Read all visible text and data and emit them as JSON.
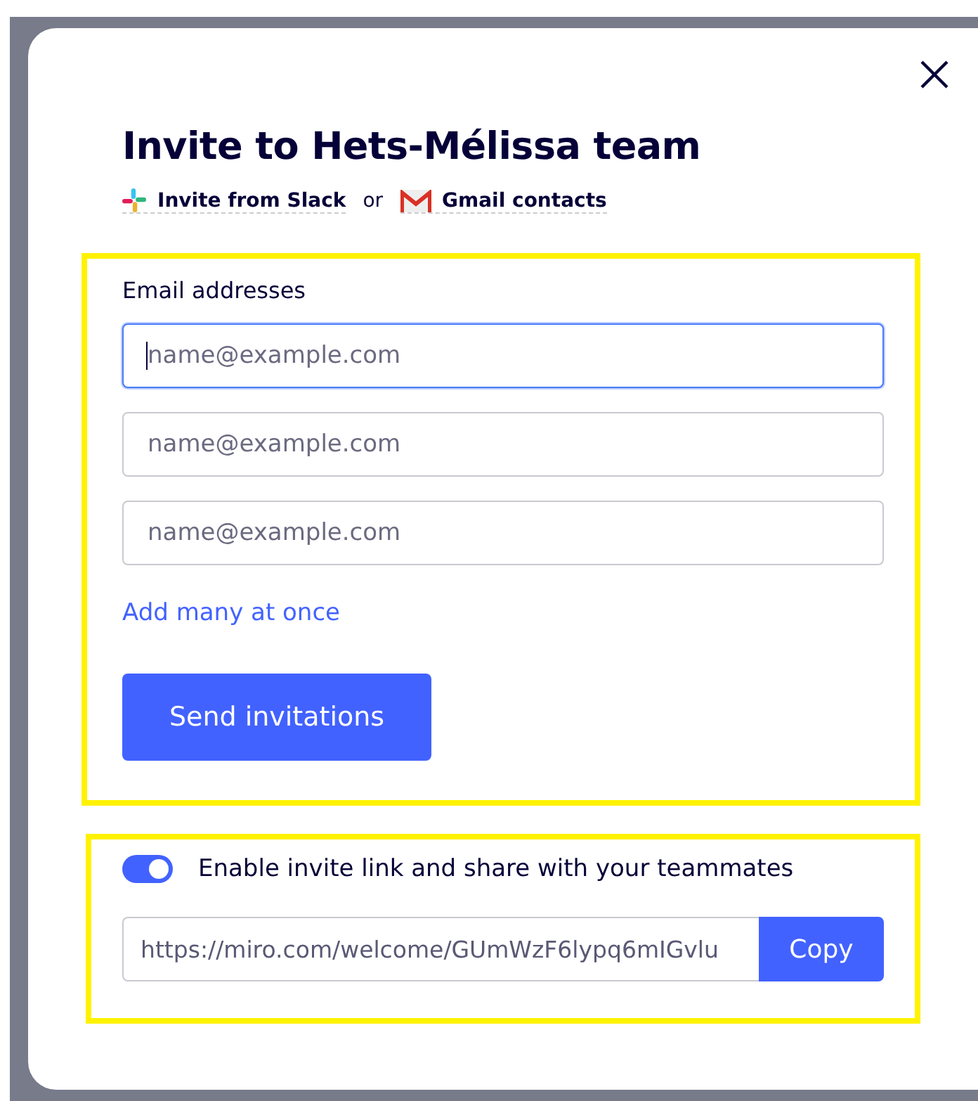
{
  "dialog": {
    "title": "Invite to Hets-Mélissa team",
    "import_links": [
      {
        "kind": "slack",
        "label": "Invite from Slack"
      },
      {
        "kind": "gmail",
        "label": "Gmail contacts"
      }
    ],
    "import_separator": "or",
    "email_section": {
      "label": "Email addresses",
      "fields": [
        {
          "placeholder": "name@example.com",
          "focused": true
        },
        {
          "placeholder": "name@example.com",
          "focused": false
        },
        {
          "placeholder": "name@example.com",
          "focused": false
        }
      ],
      "add_many_link": "Add many at once",
      "send_button": "Send invitations"
    },
    "link_section": {
      "toggle": {
        "label": "Enable invite link and share with your teammates",
        "on": true
      },
      "url": "https://miro.com/welcome/GUmWzF6lypq6mIGvlu",
      "copy_button": "Copy"
    }
  }
}
